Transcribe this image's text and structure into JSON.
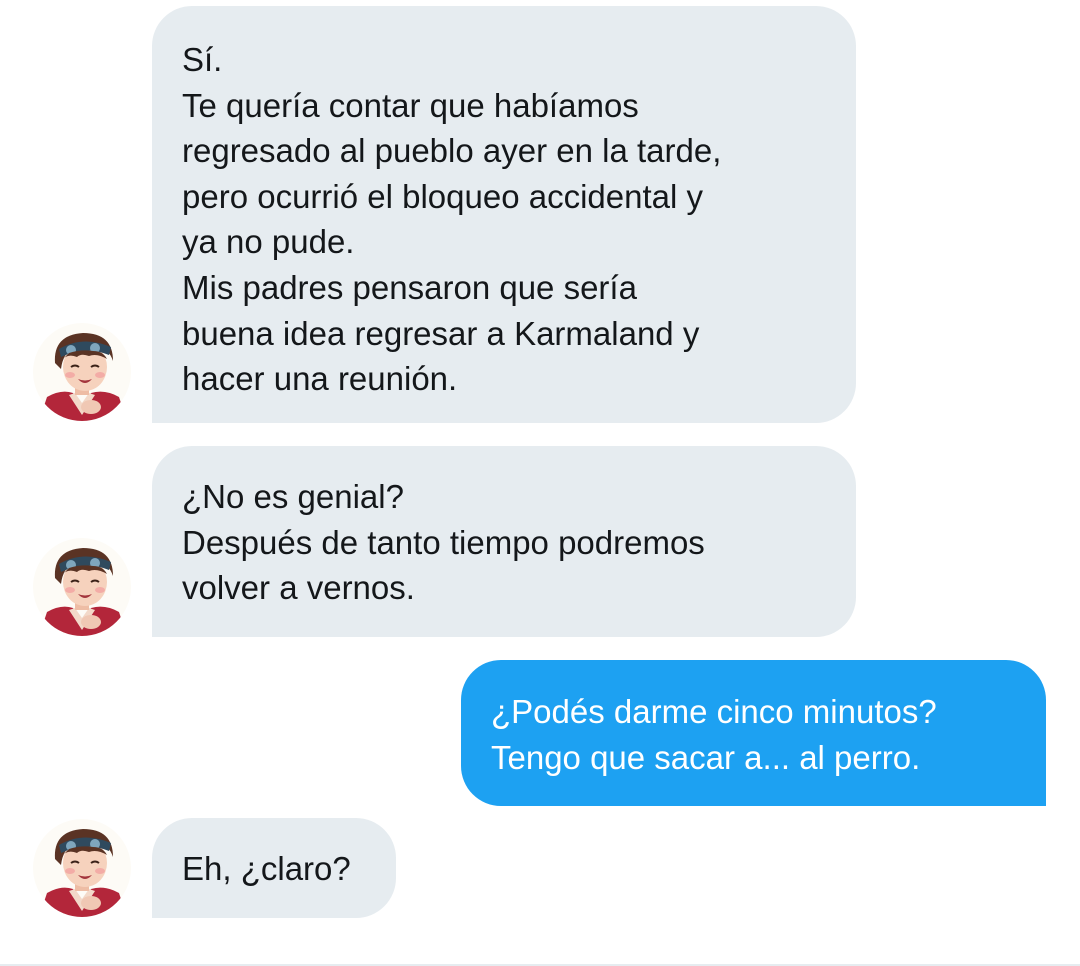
{
  "messages": [
    {
      "sender": "contact",
      "lines": [
        "Sí.",
        "Te quería contar que habíamos",
        "regresado al pueblo ayer en la tarde,",
        "pero ocurrió el bloqueo accidental y",
        "ya no pude.",
        "Mis padres pensaron que sería",
        "buena idea regresar a Karmaland y",
        "hacer una reunión."
      ]
    },
    {
      "sender": "contact",
      "lines": [
        "¿No es genial?",
        "Después de tanto tiempo podremos",
        "volver a vernos."
      ]
    },
    {
      "sender": "me",
      "lines": [
        "¿Podés darme cinco minutos?",
        "Tengo que sacar a... al perro."
      ]
    },
    {
      "sender": "contact",
      "lines": [
        "Eh, ¿claro?"
      ]
    }
  ],
  "colors": {
    "incoming_bubble": "#e6ecf0",
    "outgoing_bubble": "#1da1f2",
    "incoming_text": "#14171a",
    "outgoing_text": "#ffffff"
  },
  "icons": {
    "avatar": "contact-avatar-illustration"
  }
}
